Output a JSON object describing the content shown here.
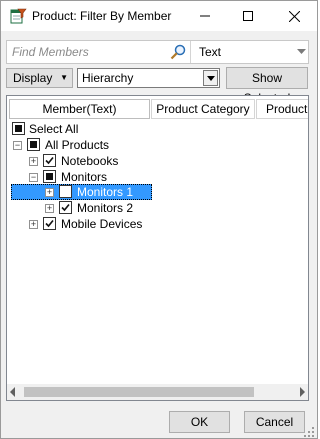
{
  "window": {
    "title": "Product: Filter By Member",
    "minimize_glyph": "—",
    "maximize_glyph": "□",
    "close_glyph": "✕",
    "icon": "excel-filter-icon"
  },
  "search": {
    "placeholder": "Find Members",
    "value": "",
    "icon": "search-icon",
    "type_value": "Text"
  },
  "toolbar": {
    "display_label": "Display",
    "hierarchy_value": "Hierarchy",
    "show_selected_label": "Show Selected"
  },
  "tree": {
    "columns": [
      "Member(Text)",
      "Product Category",
      "Product C"
    ],
    "rows": [
      {
        "label": "Select All",
        "level": 0,
        "expander": "",
        "check": "partial",
        "selected": false
      },
      {
        "label": "All Products",
        "level": 1,
        "expander": "−",
        "check": "partial",
        "selected": false
      },
      {
        "label": "Notebooks",
        "level": 2,
        "expander": "+",
        "check": "checked",
        "selected": false
      },
      {
        "label": "Monitors",
        "level": 2,
        "expander": "−",
        "check": "partial",
        "selected": false
      },
      {
        "label": "Monitors 1",
        "level": 3,
        "expander": "+",
        "check": "unchecked",
        "selected": true
      },
      {
        "label": "Monitors 2",
        "level": 3,
        "expander": "+",
        "check": "checked",
        "selected": false
      },
      {
        "label": "Mobile Devices",
        "level": 2,
        "expander": "+",
        "check": "checked",
        "selected": false
      }
    ]
  },
  "buttons": {
    "ok_label": "OK",
    "cancel_label": "Cancel"
  },
  "colors": {
    "selection": "#3399ff",
    "window_bg": "#f0f0f0"
  }
}
